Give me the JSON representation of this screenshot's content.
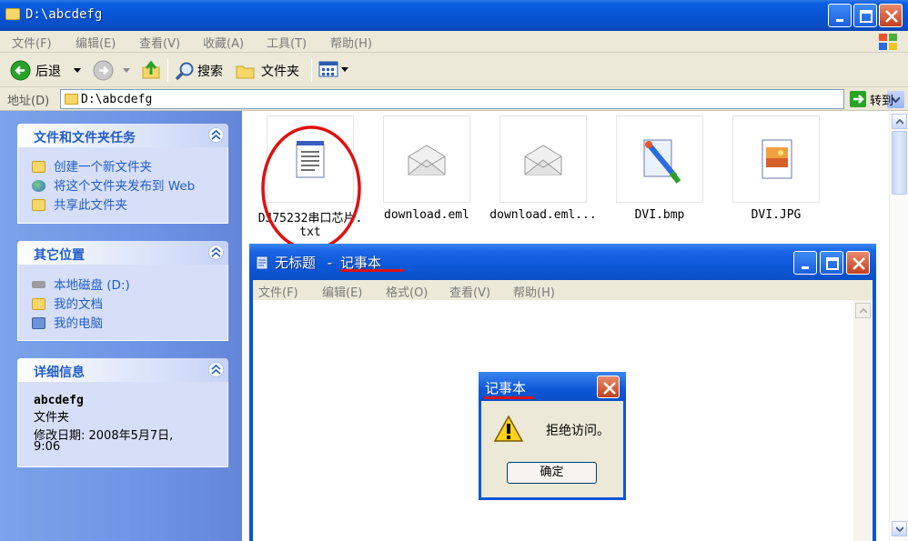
{
  "explorer": {
    "title": "D:\\abcdefg",
    "menu": [
      "文件(F)",
      "编辑(E)",
      "查看(V)",
      "收藏(A)",
      "工具(T)",
      "帮助(H)"
    ],
    "toolbar": {
      "back": "后退",
      "search": "搜索",
      "folders": "文件夹"
    },
    "address": {
      "label": "地址(D)",
      "value": "D:\\abcdefg",
      "go": "转到"
    }
  },
  "taskpane": {
    "file_tasks": {
      "title": "文件和文件夹任务",
      "items": [
        "创建一个新文件夹",
        "将这个文件夹发布到 Web",
        "共享此文件夹"
      ]
    },
    "other_places": {
      "title": "其它位置",
      "items": [
        "本地磁盘 (D:)",
        "我的文档",
        "我的电脑"
      ]
    },
    "details": {
      "title": "详细信息",
      "name": "abcdefg",
      "type": "文件夹",
      "modified_line1": "修改日期: 2008年5月7日,",
      "modified_line2": "9:06"
    }
  },
  "files": [
    {
      "name_line1": "DJ75232串口芯片.",
      "name_line2": "txt",
      "icon": "notepad-text-icon"
    },
    {
      "name_line1": "download.eml",
      "name_line2": "",
      "icon": "email-envelope-icon"
    },
    {
      "name_line1": "download.eml...",
      "name_line2": "",
      "icon": "email-envelope-icon"
    },
    {
      "name_line1": "DVI.bmp",
      "name_line2": "",
      "icon": "paint-brush-image-icon"
    },
    {
      "name_line1": "DVI.JPG",
      "name_line2": "",
      "icon": "jpeg-image-icon"
    }
  ],
  "notepad": {
    "title_doc": "无标题",
    "title_sep": "-",
    "title_app": "记事本",
    "menu": [
      "文件(F)",
      "编辑(E)",
      "格式(O)",
      "查看(V)",
      "帮助(H)"
    ]
  },
  "dialog": {
    "title": "记事本",
    "message": "拒绝访问。",
    "ok": "确定",
    "icon": "warning-icon"
  },
  "colors": {
    "xp_blue": "#0a55d8",
    "annotation_red": "#e01010",
    "link_blue": "#215dc6"
  }
}
